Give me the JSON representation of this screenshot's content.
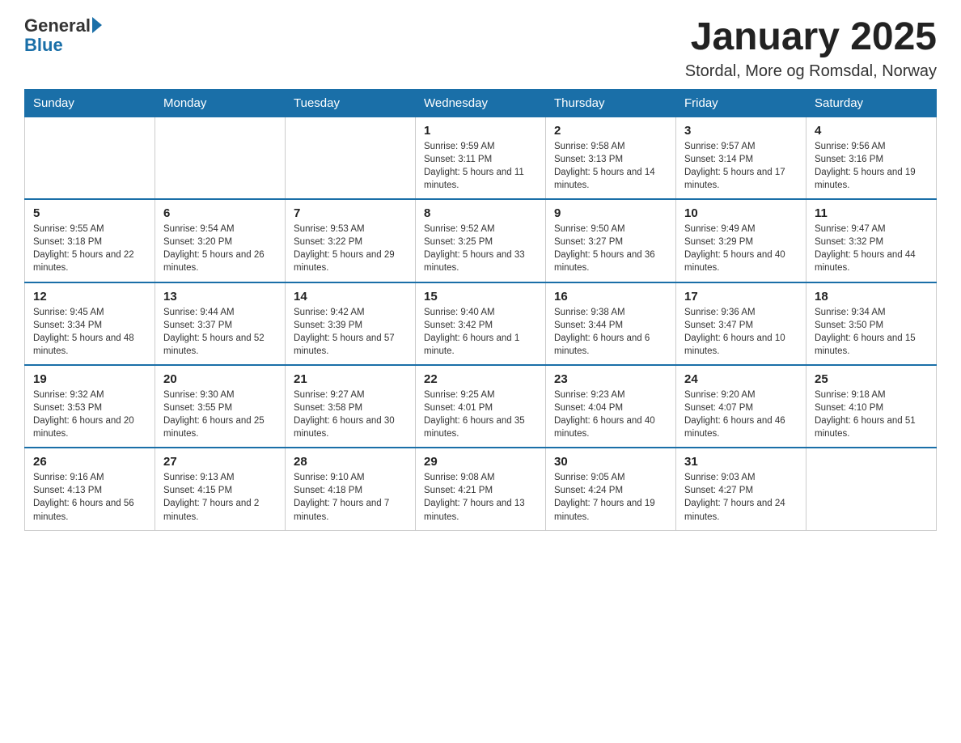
{
  "header": {
    "logo_text": "General",
    "logo_blue": "Blue",
    "title": "January 2025",
    "subtitle": "Stordal, More og Romsdal, Norway"
  },
  "days_of_week": [
    "Sunday",
    "Monday",
    "Tuesday",
    "Wednesday",
    "Thursday",
    "Friday",
    "Saturday"
  ],
  "weeks": [
    [
      {
        "num": "",
        "sunrise": "",
        "sunset": "",
        "daylight": ""
      },
      {
        "num": "",
        "sunrise": "",
        "sunset": "",
        "daylight": ""
      },
      {
        "num": "",
        "sunrise": "",
        "sunset": "",
        "daylight": ""
      },
      {
        "num": "1",
        "sunrise": "Sunrise: 9:59 AM",
        "sunset": "Sunset: 3:11 PM",
        "daylight": "Daylight: 5 hours and 11 minutes."
      },
      {
        "num": "2",
        "sunrise": "Sunrise: 9:58 AM",
        "sunset": "Sunset: 3:13 PM",
        "daylight": "Daylight: 5 hours and 14 minutes."
      },
      {
        "num": "3",
        "sunrise": "Sunrise: 9:57 AM",
        "sunset": "Sunset: 3:14 PM",
        "daylight": "Daylight: 5 hours and 17 minutes."
      },
      {
        "num": "4",
        "sunrise": "Sunrise: 9:56 AM",
        "sunset": "Sunset: 3:16 PM",
        "daylight": "Daylight: 5 hours and 19 minutes."
      }
    ],
    [
      {
        "num": "5",
        "sunrise": "Sunrise: 9:55 AM",
        "sunset": "Sunset: 3:18 PM",
        "daylight": "Daylight: 5 hours and 22 minutes."
      },
      {
        "num": "6",
        "sunrise": "Sunrise: 9:54 AM",
        "sunset": "Sunset: 3:20 PM",
        "daylight": "Daylight: 5 hours and 26 minutes."
      },
      {
        "num": "7",
        "sunrise": "Sunrise: 9:53 AM",
        "sunset": "Sunset: 3:22 PM",
        "daylight": "Daylight: 5 hours and 29 minutes."
      },
      {
        "num": "8",
        "sunrise": "Sunrise: 9:52 AM",
        "sunset": "Sunset: 3:25 PM",
        "daylight": "Daylight: 5 hours and 33 minutes."
      },
      {
        "num": "9",
        "sunrise": "Sunrise: 9:50 AM",
        "sunset": "Sunset: 3:27 PM",
        "daylight": "Daylight: 5 hours and 36 minutes."
      },
      {
        "num": "10",
        "sunrise": "Sunrise: 9:49 AM",
        "sunset": "Sunset: 3:29 PM",
        "daylight": "Daylight: 5 hours and 40 minutes."
      },
      {
        "num": "11",
        "sunrise": "Sunrise: 9:47 AM",
        "sunset": "Sunset: 3:32 PM",
        "daylight": "Daylight: 5 hours and 44 minutes."
      }
    ],
    [
      {
        "num": "12",
        "sunrise": "Sunrise: 9:45 AM",
        "sunset": "Sunset: 3:34 PM",
        "daylight": "Daylight: 5 hours and 48 minutes."
      },
      {
        "num": "13",
        "sunrise": "Sunrise: 9:44 AM",
        "sunset": "Sunset: 3:37 PM",
        "daylight": "Daylight: 5 hours and 52 minutes."
      },
      {
        "num": "14",
        "sunrise": "Sunrise: 9:42 AM",
        "sunset": "Sunset: 3:39 PM",
        "daylight": "Daylight: 5 hours and 57 minutes."
      },
      {
        "num": "15",
        "sunrise": "Sunrise: 9:40 AM",
        "sunset": "Sunset: 3:42 PM",
        "daylight": "Daylight: 6 hours and 1 minute."
      },
      {
        "num": "16",
        "sunrise": "Sunrise: 9:38 AM",
        "sunset": "Sunset: 3:44 PM",
        "daylight": "Daylight: 6 hours and 6 minutes."
      },
      {
        "num": "17",
        "sunrise": "Sunrise: 9:36 AM",
        "sunset": "Sunset: 3:47 PM",
        "daylight": "Daylight: 6 hours and 10 minutes."
      },
      {
        "num": "18",
        "sunrise": "Sunrise: 9:34 AM",
        "sunset": "Sunset: 3:50 PM",
        "daylight": "Daylight: 6 hours and 15 minutes."
      }
    ],
    [
      {
        "num": "19",
        "sunrise": "Sunrise: 9:32 AM",
        "sunset": "Sunset: 3:53 PM",
        "daylight": "Daylight: 6 hours and 20 minutes."
      },
      {
        "num": "20",
        "sunrise": "Sunrise: 9:30 AM",
        "sunset": "Sunset: 3:55 PM",
        "daylight": "Daylight: 6 hours and 25 minutes."
      },
      {
        "num": "21",
        "sunrise": "Sunrise: 9:27 AM",
        "sunset": "Sunset: 3:58 PM",
        "daylight": "Daylight: 6 hours and 30 minutes."
      },
      {
        "num": "22",
        "sunrise": "Sunrise: 9:25 AM",
        "sunset": "Sunset: 4:01 PM",
        "daylight": "Daylight: 6 hours and 35 minutes."
      },
      {
        "num": "23",
        "sunrise": "Sunrise: 9:23 AM",
        "sunset": "Sunset: 4:04 PM",
        "daylight": "Daylight: 6 hours and 40 minutes."
      },
      {
        "num": "24",
        "sunrise": "Sunrise: 9:20 AM",
        "sunset": "Sunset: 4:07 PM",
        "daylight": "Daylight: 6 hours and 46 minutes."
      },
      {
        "num": "25",
        "sunrise": "Sunrise: 9:18 AM",
        "sunset": "Sunset: 4:10 PM",
        "daylight": "Daylight: 6 hours and 51 minutes."
      }
    ],
    [
      {
        "num": "26",
        "sunrise": "Sunrise: 9:16 AM",
        "sunset": "Sunset: 4:13 PM",
        "daylight": "Daylight: 6 hours and 56 minutes."
      },
      {
        "num": "27",
        "sunrise": "Sunrise: 9:13 AM",
        "sunset": "Sunset: 4:15 PM",
        "daylight": "Daylight: 7 hours and 2 minutes."
      },
      {
        "num": "28",
        "sunrise": "Sunrise: 9:10 AM",
        "sunset": "Sunset: 4:18 PM",
        "daylight": "Daylight: 7 hours and 7 minutes."
      },
      {
        "num": "29",
        "sunrise": "Sunrise: 9:08 AM",
        "sunset": "Sunset: 4:21 PM",
        "daylight": "Daylight: 7 hours and 13 minutes."
      },
      {
        "num": "30",
        "sunrise": "Sunrise: 9:05 AM",
        "sunset": "Sunset: 4:24 PM",
        "daylight": "Daylight: 7 hours and 19 minutes."
      },
      {
        "num": "31",
        "sunrise": "Sunrise: 9:03 AM",
        "sunset": "Sunset: 4:27 PM",
        "daylight": "Daylight: 7 hours and 24 minutes."
      },
      {
        "num": "",
        "sunrise": "",
        "sunset": "",
        "daylight": ""
      }
    ]
  ]
}
